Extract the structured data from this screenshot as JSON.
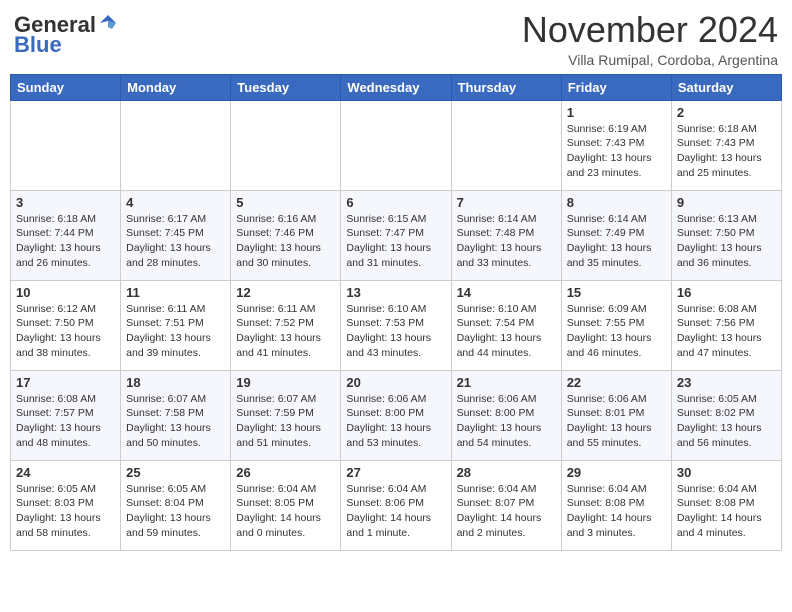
{
  "logo": {
    "general": "General",
    "blue": "Blue"
  },
  "header": {
    "month": "November 2024",
    "location": "Villa Rumipal, Cordoba, Argentina"
  },
  "weekdays": [
    "Sunday",
    "Monday",
    "Tuesday",
    "Wednesday",
    "Thursday",
    "Friday",
    "Saturday"
  ],
  "weeks": [
    [
      {
        "day": "",
        "info": ""
      },
      {
        "day": "",
        "info": ""
      },
      {
        "day": "",
        "info": ""
      },
      {
        "day": "",
        "info": ""
      },
      {
        "day": "",
        "info": ""
      },
      {
        "day": "1",
        "info": "Sunrise: 6:19 AM\nSunset: 7:43 PM\nDaylight: 13 hours\nand 23 minutes."
      },
      {
        "day": "2",
        "info": "Sunrise: 6:18 AM\nSunset: 7:43 PM\nDaylight: 13 hours\nand 25 minutes."
      }
    ],
    [
      {
        "day": "3",
        "info": "Sunrise: 6:18 AM\nSunset: 7:44 PM\nDaylight: 13 hours\nand 26 minutes."
      },
      {
        "day": "4",
        "info": "Sunrise: 6:17 AM\nSunset: 7:45 PM\nDaylight: 13 hours\nand 28 minutes."
      },
      {
        "day": "5",
        "info": "Sunrise: 6:16 AM\nSunset: 7:46 PM\nDaylight: 13 hours\nand 30 minutes."
      },
      {
        "day": "6",
        "info": "Sunrise: 6:15 AM\nSunset: 7:47 PM\nDaylight: 13 hours\nand 31 minutes."
      },
      {
        "day": "7",
        "info": "Sunrise: 6:14 AM\nSunset: 7:48 PM\nDaylight: 13 hours\nand 33 minutes."
      },
      {
        "day": "8",
        "info": "Sunrise: 6:14 AM\nSunset: 7:49 PM\nDaylight: 13 hours\nand 35 minutes."
      },
      {
        "day": "9",
        "info": "Sunrise: 6:13 AM\nSunset: 7:50 PM\nDaylight: 13 hours\nand 36 minutes."
      }
    ],
    [
      {
        "day": "10",
        "info": "Sunrise: 6:12 AM\nSunset: 7:50 PM\nDaylight: 13 hours\nand 38 minutes."
      },
      {
        "day": "11",
        "info": "Sunrise: 6:11 AM\nSunset: 7:51 PM\nDaylight: 13 hours\nand 39 minutes."
      },
      {
        "day": "12",
        "info": "Sunrise: 6:11 AM\nSunset: 7:52 PM\nDaylight: 13 hours\nand 41 minutes."
      },
      {
        "day": "13",
        "info": "Sunrise: 6:10 AM\nSunset: 7:53 PM\nDaylight: 13 hours\nand 43 minutes."
      },
      {
        "day": "14",
        "info": "Sunrise: 6:10 AM\nSunset: 7:54 PM\nDaylight: 13 hours\nand 44 minutes."
      },
      {
        "day": "15",
        "info": "Sunrise: 6:09 AM\nSunset: 7:55 PM\nDaylight: 13 hours\nand 46 minutes."
      },
      {
        "day": "16",
        "info": "Sunrise: 6:08 AM\nSunset: 7:56 PM\nDaylight: 13 hours\nand 47 minutes."
      }
    ],
    [
      {
        "day": "17",
        "info": "Sunrise: 6:08 AM\nSunset: 7:57 PM\nDaylight: 13 hours\nand 48 minutes."
      },
      {
        "day": "18",
        "info": "Sunrise: 6:07 AM\nSunset: 7:58 PM\nDaylight: 13 hours\nand 50 minutes."
      },
      {
        "day": "19",
        "info": "Sunrise: 6:07 AM\nSunset: 7:59 PM\nDaylight: 13 hours\nand 51 minutes."
      },
      {
        "day": "20",
        "info": "Sunrise: 6:06 AM\nSunset: 8:00 PM\nDaylight: 13 hours\nand 53 minutes."
      },
      {
        "day": "21",
        "info": "Sunrise: 6:06 AM\nSunset: 8:00 PM\nDaylight: 13 hours\nand 54 minutes."
      },
      {
        "day": "22",
        "info": "Sunrise: 6:06 AM\nSunset: 8:01 PM\nDaylight: 13 hours\nand 55 minutes."
      },
      {
        "day": "23",
        "info": "Sunrise: 6:05 AM\nSunset: 8:02 PM\nDaylight: 13 hours\nand 56 minutes."
      }
    ],
    [
      {
        "day": "24",
        "info": "Sunrise: 6:05 AM\nSunset: 8:03 PM\nDaylight: 13 hours\nand 58 minutes."
      },
      {
        "day": "25",
        "info": "Sunrise: 6:05 AM\nSunset: 8:04 PM\nDaylight: 13 hours\nand 59 minutes."
      },
      {
        "day": "26",
        "info": "Sunrise: 6:04 AM\nSunset: 8:05 PM\nDaylight: 14 hours\nand 0 minutes."
      },
      {
        "day": "27",
        "info": "Sunrise: 6:04 AM\nSunset: 8:06 PM\nDaylight: 14 hours\nand 1 minute."
      },
      {
        "day": "28",
        "info": "Sunrise: 6:04 AM\nSunset: 8:07 PM\nDaylight: 14 hours\nand 2 minutes."
      },
      {
        "day": "29",
        "info": "Sunrise: 6:04 AM\nSunset: 8:08 PM\nDaylight: 14 hours\nand 3 minutes."
      },
      {
        "day": "30",
        "info": "Sunrise: 6:04 AM\nSunset: 8:08 PM\nDaylight: 14 hours\nand 4 minutes."
      }
    ]
  ]
}
